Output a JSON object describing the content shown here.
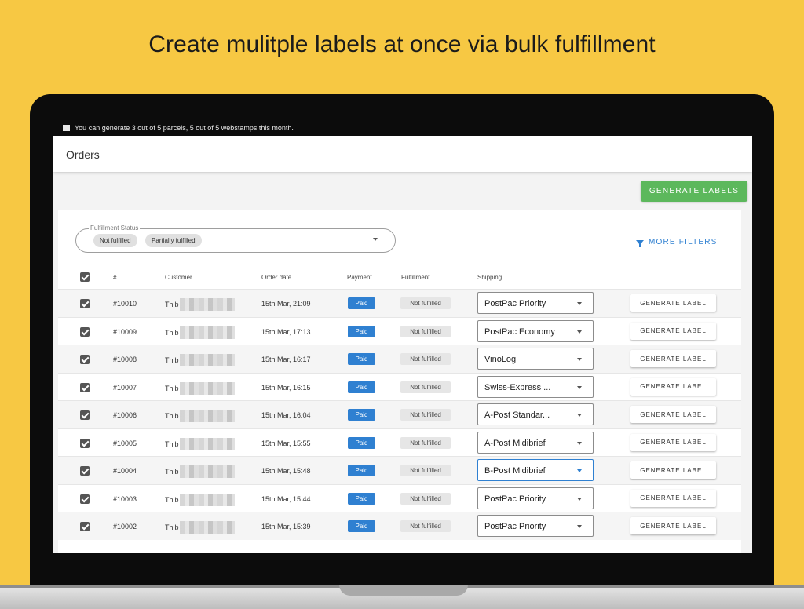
{
  "headline": "Create mulitple labels at once via bulk fulfillment",
  "notice": "You can generate 3 out of 5 parcels, 5 out of 5 webstamps this month.",
  "page_title": "Orders",
  "generate_labels_button": "GENERATE LABELS",
  "filter": {
    "legend": "Fulfillment Status",
    "chips": [
      "Not fulfilled",
      "Partially fulfilled"
    ]
  },
  "more_filters": "MORE FILTERS",
  "columns": [
    "#",
    "Customer",
    "Order date",
    "Payment",
    "Fulfillment",
    "Shipping"
  ],
  "rows": [
    {
      "id": "#10010",
      "customer": "Thib",
      "date": "15th Mar, 21:09",
      "payment": "Paid",
      "fulfillment": "Not fulfilled",
      "shipping": "PostPac Priority",
      "action": "GENERATE LABEL"
    },
    {
      "id": "#10009",
      "customer": "Thib",
      "date": "15th Mar, 17:13",
      "payment": "Paid",
      "fulfillment": "Not fulfilled",
      "shipping": "PostPac Economy",
      "action": "GENERATE LABEL"
    },
    {
      "id": "#10008",
      "customer": "Thib",
      "date": "15th Mar, 16:17",
      "payment": "Paid",
      "fulfillment": "Not fulfilled",
      "shipping": "VinoLog",
      "action": "GENERATE LABEL"
    },
    {
      "id": "#10007",
      "customer": "Thib",
      "date": "15th Mar, 16:15",
      "payment": "Paid",
      "fulfillment": "Not fulfilled",
      "shipping": "Swiss-Express ...",
      "action": "GENERATE LABEL"
    },
    {
      "id": "#10006",
      "customer": "Thib",
      "date": "15th Mar, 16:04",
      "payment": "Paid",
      "fulfillment": "Not fulfilled",
      "shipping": "A-Post Standar...",
      "action": "GENERATE LABEL"
    },
    {
      "id": "#10005",
      "customer": "Thib",
      "date": "15th Mar, 15:55",
      "payment": "Paid",
      "fulfillment": "Not fulfilled",
      "shipping": "A-Post Midibrief",
      "action": "GENERATE LABEL"
    },
    {
      "id": "#10004",
      "customer": "Thib",
      "date": "15th Mar, 15:48",
      "payment": "Paid",
      "fulfillment": "Not fulfilled",
      "shipping": "B-Post Midibrief",
      "action": "GENERATE LABEL"
    },
    {
      "id": "#10003",
      "customer": "Thib",
      "date": "15th Mar, 15:44",
      "payment": "Paid",
      "fulfillment": "Not fulfilled",
      "shipping": "PostPac Priority",
      "action": "GENERATE LABEL"
    },
    {
      "id": "#10002",
      "customer": "Thib",
      "date": "15th Mar, 15:39",
      "payment": "Paid",
      "fulfillment": "Not fulfilled",
      "shipping": "PostPac Priority",
      "action": "GENERATE LABEL"
    }
  ],
  "colors": {
    "background": "#F7C843",
    "primary_action": "#5cb85c",
    "accent": "#2f80d1"
  },
  "icons": [
    "notice-flag-icon",
    "checkbox-checked-icon",
    "filter-funnel-icon",
    "dropdown-arrow-icon"
  ]
}
